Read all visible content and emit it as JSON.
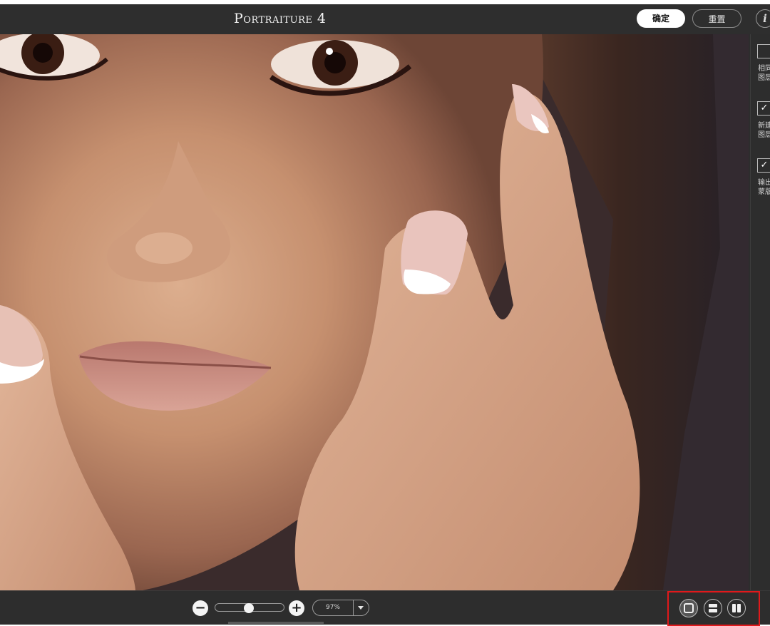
{
  "app": {
    "title": "Portraiture 4"
  },
  "header": {
    "ok_label": "确定",
    "reset_label": "重置",
    "info_glyph": "i"
  },
  "right_panel": {
    "options": [
      {
        "label_line1": "相同",
        "label_line2": "图层",
        "checked": false
      },
      {
        "label_line1": "新建",
        "label_line2": "图层",
        "checked": true
      },
      {
        "label_line1": "输出",
        "label_line2": "蒙版",
        "checked": true
      }
    ],
    "check_glyph": "✓"
  },
  "bottom_bar": {
    "zoom_out_glyph": "−",
    "zoom_in_glyph": "+",
    "zoom_value": "97%",
    "zoom_slider_fraction": 0.49,
    "view_modes": [
      {
        "icon": "single-view-icon",
        "active": true
      },
      {
        "icon": "split-horizontal-icon",
        "active": false
      },
      {
        "icon": "split-vertical-icon",
        "active": false
      }
    ]
  },
  "colors": {
    "background": "#2d2d2d",
    "highlight": "#e0191b",
    "text": "#f2f2f2"
  }
}
